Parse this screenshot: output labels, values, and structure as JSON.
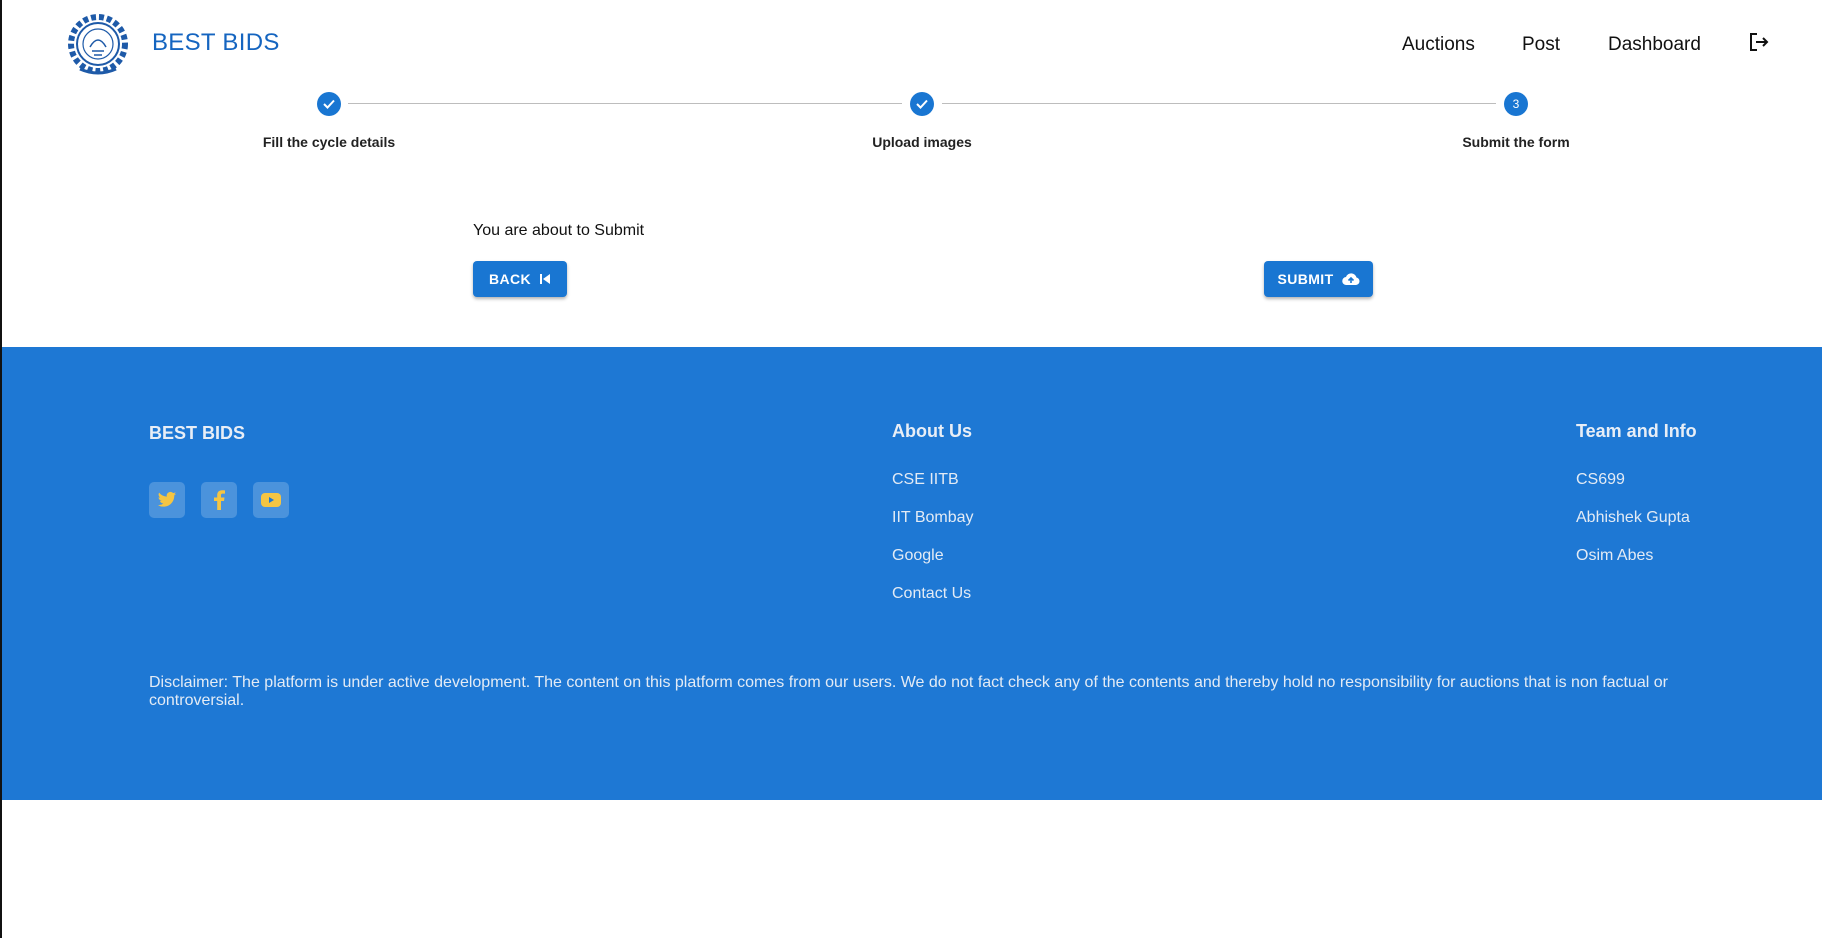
{
  "header": {
    "brand": "BEST BIDS",
    "nav": [
      "Auctions",
      "Post",
      "Dashboard"
    ],
    "logout_icon": "logout-icon"
  },
  "stepper": {
    "steps": [
      {
        "label": "Fill the cycle details",
        "state": "completed"
      },
      {
        "label": "Upload images",
        "state": "completed"
      },
      {
        "label": "Submit the form",
        "state": "active",
        "number": "3"
      }
    ]
  },
  "main": {
    "prompt": "You are about to Submit",
    "back_label": "BACK",
    "submit_label": "SUBMIT"
  },
  "footer": {
    "brand": "BEST BIDS",
    "social_icons": [
      "twitter-icon",
      "facebook-icon",
      "youtube-icon"
    ],
    "about": {
      "heading": "About Us",
      "links": [
        "CSE IITB",
        "IIT Bombay",
        "Google",
        "Contact Us"
      ]
    },
    "team": {
      "heading": "Team and Info",
      "links": [
        "CS699",
        "Abhishek Gupta",
        "Osim Abes"
      ]
    },
    "disclaimer": "Disclaimer: The platform is under active development. The content on this platform comes from our users. We do not fact check any of the contents and thereby hold no responsibility for auctions that is non factual or controversial."
  },
  "colors": {
    "primary": "#1976d2",
    "footer_bg": "#1e78d4",
    "brand_text": "#1565c0",
    "social_icon": "#f5c542"
  }
}
